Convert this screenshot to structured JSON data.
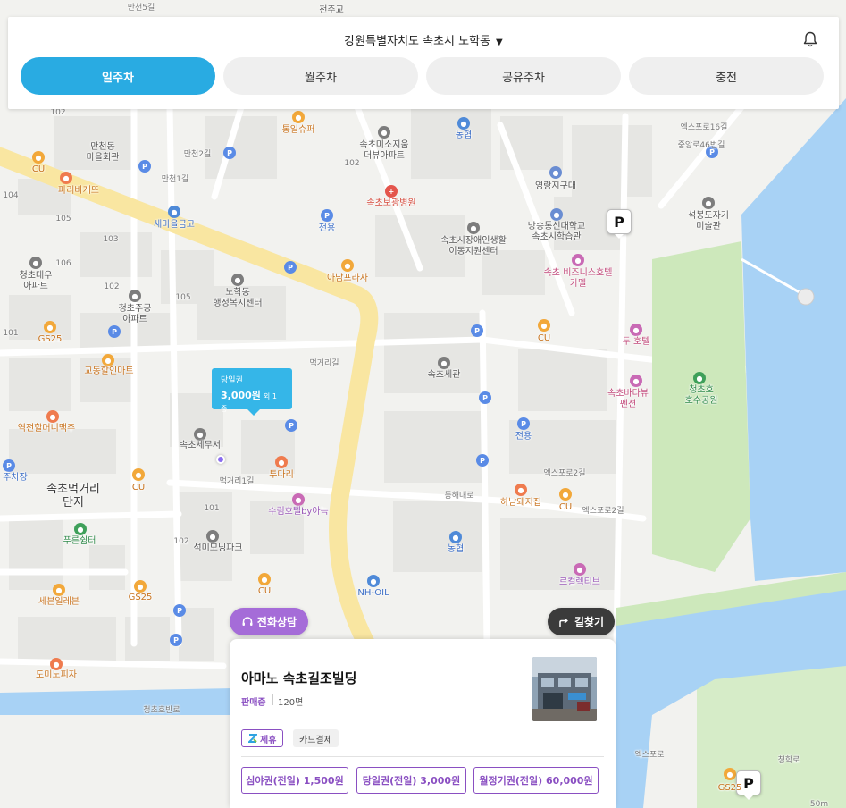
{
  "header": {
    "location": "강원특별자치도 속초시 노학동",
    "tabs": [
      {
        "label": "일주차",
        "active": true
      },
      {
        "label": "월주차",
        "active": false
      },
      {
        "label": "공유주차",
        "active": false
      },
      {
        "label": "충전",
        "active": false
      }
    ]
  },
  "map": {
    "marker": {
      "label": "당일권",
      "price": "3,000원",
      "extra": "외 1종"
    },
    "labels": {
      "l01": "만천5길",
      "l02": "천주교",
      "l03": "통일슈퍼",
      "l04": "농협",
      "l05": "속초미소지움\n더뷰아파트",
      "l06": "만천동\n마을회관",
      "l07": "만천2길",
      "l08": "만천1길",
      "l09": "CU",
      "l10": "파리바게뜨",
      "l11": "새마을금고",
      "l12": "속초보광병원",
      "l13": "영랑지구대",
      "l14": "방송통신대학교\n속초시학습관",
      "l15": "석봉도자기\n미술관",
      "l16": "전용",
      "l17": "속초시장애인생활\n이동지원센터",
      "l18": "아남프라자",
      "l19": "속초 비즈니스호텔\n카멜",
      "l20": "청초대우\n아파트",
      "l21": "청초주공\n아파트",
      "l22": "노학동\n행정복지센터",
      "l23": "GS25",
      "l24": "CU",
      "l25": "두 호텔",
      "l26": "교동할인마트",
      "l27": "먹거리길",
      "l28": "속초세관",
      "l29": "속초바다뷰\n펜션",
      "l30": "청초호\n호수공원",
      "l31": "역전할머니맥주",
      "l32": "속초세무서",
      "l33": "전용",
      "l34": "투다리",
      "l35": "엑스포로2길",
      "l36": "속초먹거리\n단지",
      "l37": "CU",
      "l38": "먹거리1길",
      "l39": "수림호텔by아늑",
      "l40": "동해대로",
      "l41": "하남돼지집",
      "l42": "CU",
      "l43": "엑스포로2길",
      "l44": "푸른쉼터",
      "l45": "석미모닝파크",
      "l46": "농협",
      "l47": "르컬렉티브",
      "l48": "세븐일레븐",
      "l49": "GS25",
      "l50": "CU",
      "l51": "NH-OIL",
      "l52": "도미노피자",
      "l53": "엑스포로",
      "l54": "청초호반로",
      "l55": "GS25",
      "l56": "주차장",
      "l57": "엑스포로16길",
      "l58": "중앙로46번길",
      "l59": "청학로",
      "l60": "50m",
      "n01": "102",
      "n02": "104",
      "n03": "105",
      "n04": "103",
      "n05": "106",
      "n06": "102",
      "n07": "101",
      "n08": "105",
      "n09": "102",
      "n10": "101",
      "n11": "102"
    }
  },
  "buttons": {
    "consult": "전화상담",
    "route": "길찾기"
  },
  "card": {
    "title": "아마노 속초길조빌딩",
    "status": "판매중",
    "spots": "120면",
    "tags": {
      "partner": "제휴",
      "card_payment": "카드결제"
    },
    "tickets": [
      "심야권(전일) 1,500원",
      "당일권(전일) 3,000원",
      "월정기권(전일) 60,000원"
    ]
  },
  "colors": {
    "accent": "#29abe2",
    "purple": "#8a4fc2",
    "water": "#a8d2f5",
    "park": "#c8e6b4",
    "main_road": "#fae8a0"
  }
}
